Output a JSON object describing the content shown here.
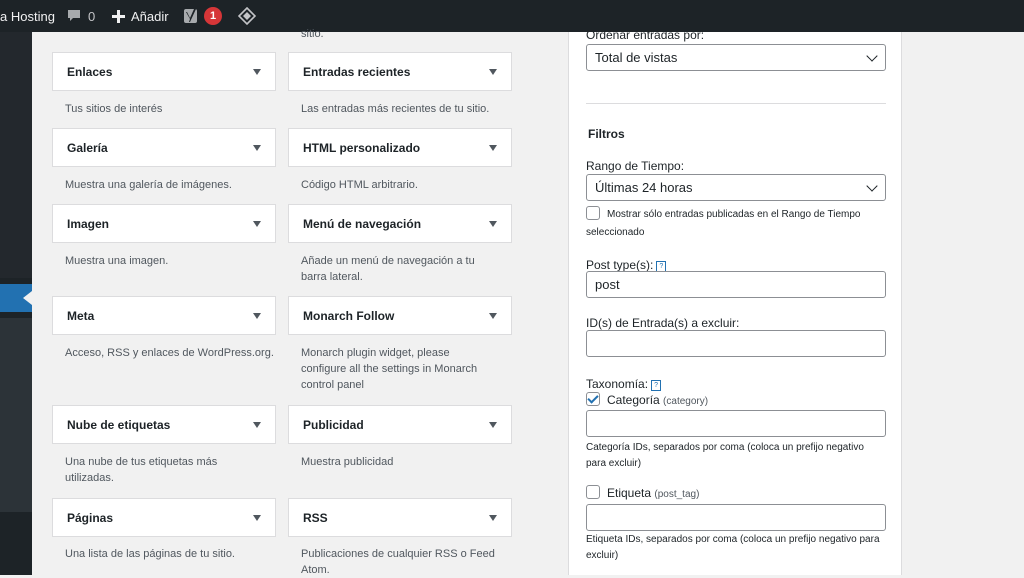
{
  "adminbar": {
    "site_label": "a Hosting",
    "comments_count": "0",
    "add_label": "Añadir",
    "yoast_badge": "1"
  },
  "top_cutoff_text": "sitio.",
  "widgets": [
    {
      "title": "Enlaces",
      "desc": "Tus sitios de interés"
    },
    {
      "title": "Entradas recientes",
      "desc": "Las entradas más recientes de tu sitio."
    },
    {
      "title": "Galería",
      "desc": "Muestra una galería de imágenes."
    },
    {
      "title": "HTML personalizado",
      "desc": "Código HTML arbitrario."
    },
    {
      "title": "Imagen",
      "desc": "Muestra una imagen."
    },
    {
      "title": "Menú de navegación",
      "desc": "Añade un menú de navegación a tu barra lateral."
    },
    {
      "title": "Meta",
      "desc": "Acceso, RSS y enlaces de WordPress.org."
    },
    {
      "title": "Monarch Follow",
      "desc": "Monarch plugin widget, please configure all the settings in Monarch control panel"
    },
    {
      "title": "Nube de etiquetas",
      "desc": "Una nube de tus etiquetas más utilizadas."
    },
    {
      "title": "Publicidad",
      "desc": "Muestra publicidad"
    },
    {
      "title": "Páginas",
      "desc": "Una lista de las páginas de tu sitio."
    },
    {
      "title": "RSS",
      "desc": "Publicaciones de cualquier RSS o Feed Atom."
    }
  ],
  "panel": {
    "order_label": "Ordenar entradas por:",
    "order_value": "Total de vistas",
    "filters_heading": "Filtros",
    "time_range_label": "Rango de Tiempo:",
    "time_range_value": "Últimas 24 horas",
    "published_only_label": "Mostrar sólo entradas publicadas en el Rango de Tiempo",
    "published_only_label_2": "seleccionado",
    "post_types_label": "Post type(s):",
    "post_types_value": "post",
    "exclude_ids_label": "ID(s) de Entrada(s) a excluir:",
    "exclude_ids_value": "",
    "taxonomy_label": "Taxonomía:",
    "help_glyph": "?",
    "category_label": "Categoría",
    "category_slug": "(category)",
    "category_value": "",
    "category_hint": "Categoría IDs, separados por coma (coloca un prefijo negativo para excluir)",
    "tag_label": "Etiqueta",
    "tag_slug": "(post_tag)",
    "tag_value": "",
    "tag_hint": "Etiqueta IDs, separados por coma (coloca un prefijo negativo para excluir)",
    "category_checked": true,
    "tag_checked": false,
    "published_only_checked": false
  },
  "colors": {
    "adminbar_bg": "#1d2327",
    "accent": "#2271b1",
    "badge": "#d63638"
  }
}
